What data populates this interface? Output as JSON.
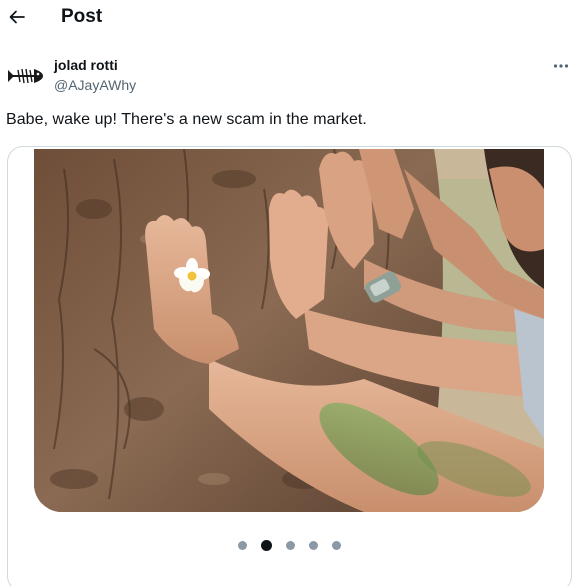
{
  "header": {
    "title": "Post",
    "back_icon": "arrow-left-icon"
  },
  "post": {
    "author_name": "jolad rotti",
    "author_handle": "@AJayAWhy",
    "avatar_icon": "fish-skeleton-icon",
    "more_icon": "more-horizontal-icon",
    "text": "Babe, wake up! There's a new scam in the market."
  },
  "media": {
    "image_description_icon": "tree-bark-hands-photo",
    "carousel": {
      "total": 5,
      "active_index": 1
    }
  },
  "colors": {
    "text_primary": "#0f1419",
    "text_secondary": "#536471",
    "border": "#cfd9de",
    "dot_inactive": "#8b98a5",
    "dot_active": "#0f1419"
  }
}
